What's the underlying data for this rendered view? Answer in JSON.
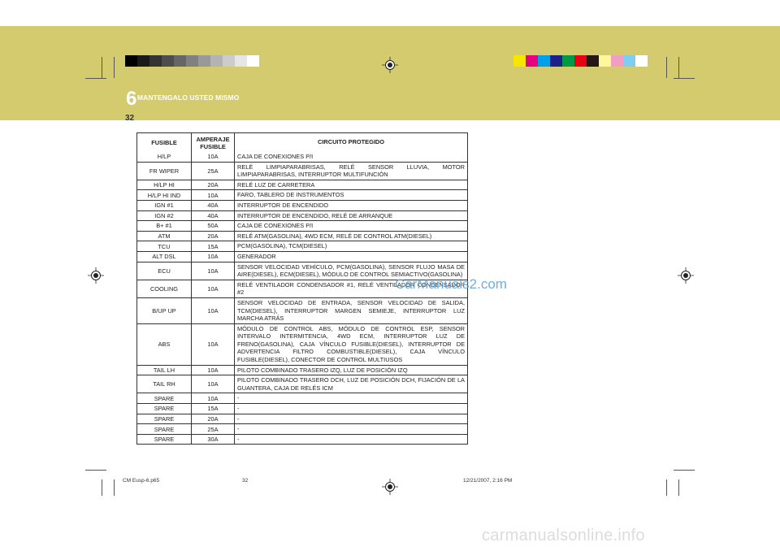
{
  "header": {
    "chapter_number": "6",
    "chapter_title": "MANTENGALO USTED MISMO",
    "page_number": "32",
    "gray_bar_colors": [
      "#000000",
      "#1a1a1a",
      "#333333",
      "#4d4d4d",
      "#666666",
      "#808080",
      "#999999",
      "#b3b3b3",
      "#cccccc",
      "#e6e6e6",
      "#ffffff"
    ],
    "color_bar_colors": [
      "#f5e600",
      "#e6007e",
      "#00a0e9",
      "#1d2088",
      "#009944",
      "#e60012",
      "#231815",
      "#fff799",
      "#f19ec2",
      "#7ecef4",
      "#ffffff"
    ]
  },
  "table": {
    "headers": {
      "fuse": "FUSIBLE",
      "amperage": "AMPERAJE FUSIBLE",
      "circuit": "CIRCUITO PROTEGIDO"
    },
    "rows": [
      {
        "fuse": "H/LP",
        "amp": "10A",
        "circuit": "CAJA DE CONEXIONES P/I"
      },
      {
        "fuse": "FR WIPER",
        "amp": "25A",
        "circuit": "RELÉ LIMPIAPARABRISAS, RELÉ SENSOR LLUVIA, MOTOR LIMPIAPARABRISAS, INTERRUPTOR MULTIFUNCIÓN"
      },
      {
        "fuse": "H/LP HI",
        "amp": "20A",
        "circuit": "RELÉ LUZ DE CARRETERA"
      },
      {
        "fuse": "H/LP HI IND",
        "amp": "10A",
        "circuit": "FARO, TABLERO DE INSTRUMENTOS"
      },
      {
        "fuse": "IGN #1",
        "amp": "40A",
        "circuit": "INTERRUPTOR DE ENCENDIDO"
      },
      {
        "fuse": "IGN #2",
        "amp": "40A",
        "circuit": "INTERRUPTOR DE ENCENDIDO, RELÉ DE ARRANQUE"
      },
      {
        "fuse": "B+ #1",
        "amp": "50A",
        "circuit": "CAJA DE CONEXIONES P/I"
      },
      {
        "fuse": "ATM",
        "amp": "20A",
        "circuit": "RELÉ ATM(GASOLINA), 4WD ECM, RELÉ DE CONTROL ATM(DIESEL)"
      },
      {
        "fuse": "TCU",
        "amp": "15A",
        "circuit": "PCM(GASOLINA), TCM(DIESEL)"
      },
      {
        "fuse": "ALT DSL",
        "amp": "10A",
        "circuit": "GENERADOR"
      },
      {
        "fuse": "ECU",
        "amp": "10A",
        "circuit": "SENSOR VELOCIDAD VEHÍCULO, PCM(GASOLINA), SENSOR FLUJO MASA DE AIRE(DIESEL), ECM(DIESEL), MÓDULO DE CONTROL SEMIACTIVO(GASOLINA)"
      },
      {
        "fuse": "COOLING",
        "amp": "10A",
        "circuit": "RELÉ VENTILADOR CONDENSADOR #1, RELÉ VENTILADOR CONDENSADOR #2"
      },
      {
        "fuse": "B/UP UP",
        "amp": "10A",
        "circuit": "SENSOR VELOCIDAD DE ENTRADA, SENSOR VELOCIDAD DE SALIDA, TCM(DIESEL), INTERRUPTOR MARGEN SEMIEJE, INTERRUPTOR LUZ MARCHA ATRÁS"
      },
      {
        "fuse": "ABS",
        "amp": "10A",
        "circuit": "MÓDULO DE CONTROL ABS, MÓDULO DE CONTROL ESP, SENSOR INTERVALO INTERMITENCIA, 4WD ECM, INTERRUPTOR LUZ DE FRENO(GASOLINA), CAJA VÍNCULO FUSIBLE(DIESEL), INTERRUPTOR DE ADVERTENCIA FILTRO COMBUSTIBLE(DIESEL), CAJA VÍNCULO FUSIBLE(DIESEL), CONECTOR DE CONTROL MULTIUSOS"
      },
      {
        "fuse": "TAIL LH",
        "amp": "10A",
        "circuit": "PILOTO COMBINADO TRASERO IZQ, LUZ DE POSICIÓN IZQ"
      },
      {
        "fuse": "TAIL RH",
        "amp": "10A",
        "circuit": "PILOTO COMBINADO TRASERO DCH, LUZ DE POSICIÓN DCH, FIJACIÓN DE LA GUANTERA, CAJA DE RELÉS ICM"
      },
      {
        "fuse": "SPARE",
        "amp": "10A",
        "circuit": "-"
      },
      {
        "fuse": "SPARE",
        "amp": "15A",
        "circuit": "-"
      },
      {
        "fuse": "SPARE",
        "amp": "20A",
        "circuit": "-"
      },
      {
        "fuse": "SPARE",
        "amp": "25A",
        "circuit": "-"
      },
      {
        "fuse": "SPARE",
        "amp": "30A",
        "circuit": "-"
      }
    ]
  },
  "watermark": "CarManuals2.com",
  "footer": {
    "file": "CM Eusp-6.p65",
    "page": "32",
    "datetime": "12/21/2007, 2:16 PM"
  },
  "site_watermark": "carmanualsonline.info"
}
